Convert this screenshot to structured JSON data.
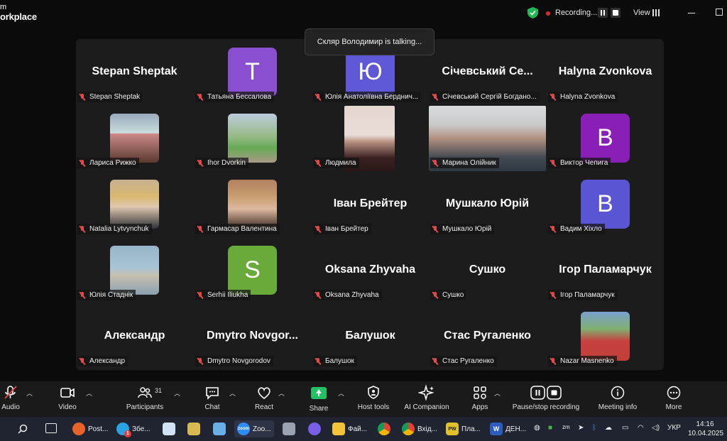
{
  "app": {
    "brand_line1": "m",
    "brand_line2": "orkplace",
    "recording_label": "Recording...",
    "view_label": "View"
  },
  "talking_banner": "Скляр Володимир is talking...",
  "tiles": [
    {
      "name": "Stepan Sheptak",
      "big": "Stepan Sheptak"
    },
    {
      "name": "Татьяна Бессалова",
      "letter": "T",
      "color": "#8a4fd0"
    },
    {
      "name": "Юлія Анатоліївна Берднич...",
      "letter": "Ю",
      "color": "#5f58d6"
    },
    {
      "name": "Січевський Сергій Богдано...",
      "big": "Січевський Се..."
    },
    {
      "name": "Halyna Zvonkova",
      "big": "Halyna Zvonkova"
    },
    {
      "name": "Лариса Рижко"
    },
    {
      "name": "Ihor Dvorkin"
    },
    {
      "name": "Людмила"
    },
    {
      "name": "Марина Олійник"
    },
    {
      "name": "Виктор Чепига",
      "letter": "B",
      "color": "#8a1fb8"
    },
    {
      "name": "Natalia Lytvynchuk"
    },
    {
      "name": "Гармасар Валентина"
    },
    {
      "name": "Іван Брейтер",
      "big": "Іван Брейтер"
    },
    {
      "name": "Мушкало Юрій",
      "big": "Мушкало Юрій"
    },
    {
      "name": "Вадим Хіхло",
      "letter": "B",
      "color": "#5a55d2"
    },
    {
      "name": "Юлія Стаднік"
    },
    {
      "name": "Serhii Iliukha",
      "letter": "S",
      "color": "#6aaa3a"
    },
    {
      "name": "Oksana Zhyvaha",
      "big": "Oksana Zhyvaha"
    },
    {
      "name": "Сушко",
      "big": "Сушко"
    },
    {
      "name": "Ігор Паламарчук",
      "big": "Ігор Паламарчук"
    },
    {
      "name": "Александр",
      "big": "Александр"
    },
    {
      "name": "Dmytro Novgorodov",
      "big": "Dmytro  Novgor..."
    },
    {
      "name": "Балушок",
      "big": "Балушок"
    },
    {
      "name": "Стас Ругаленко",
      "big": "Стас Ругаленко"
    },
    {
      "name": "Nazar Masnenko"
    }
  ],
  "toolbar": {
    "audio": "Audio",
    "video": "Video",
    "participants": "Participants",
    "participants_count": "31",
    "chat": "Chat",
    "react": "React",
    "share": "Share",
    "host_tools": "Host tools",
    "ai_companion": "AI Companion",
    "apps": "Apps",
    "pause_stop": "Pause/stop recording",
    "meeting_info": "Meeting info",
    "more": "More"
  },
  "taskbar": {
    "postman": "Post...",
    "telegram": "Збе...",
    "zoom": "Zoo...",
    "files": "Фай...",
    "chrome_inbox": "Вхід...",
    "pw": "Пла...",
    "word": "ДЕН...",
    "telegram_badge": "1",
    "pw_icon": "PW",
    "word_icon": "W",
    "zm_icon": "zm",
    "zoom_icon": "zoom",
    "lang": "УКР",
    "time": "14:16",
    "date": "10.04.2025"
  },
  "colors": {
    "recording": "#e02a2a",
    "share_green": "#21c164",
    "mic_off": "#e24a4a"
  }
}
